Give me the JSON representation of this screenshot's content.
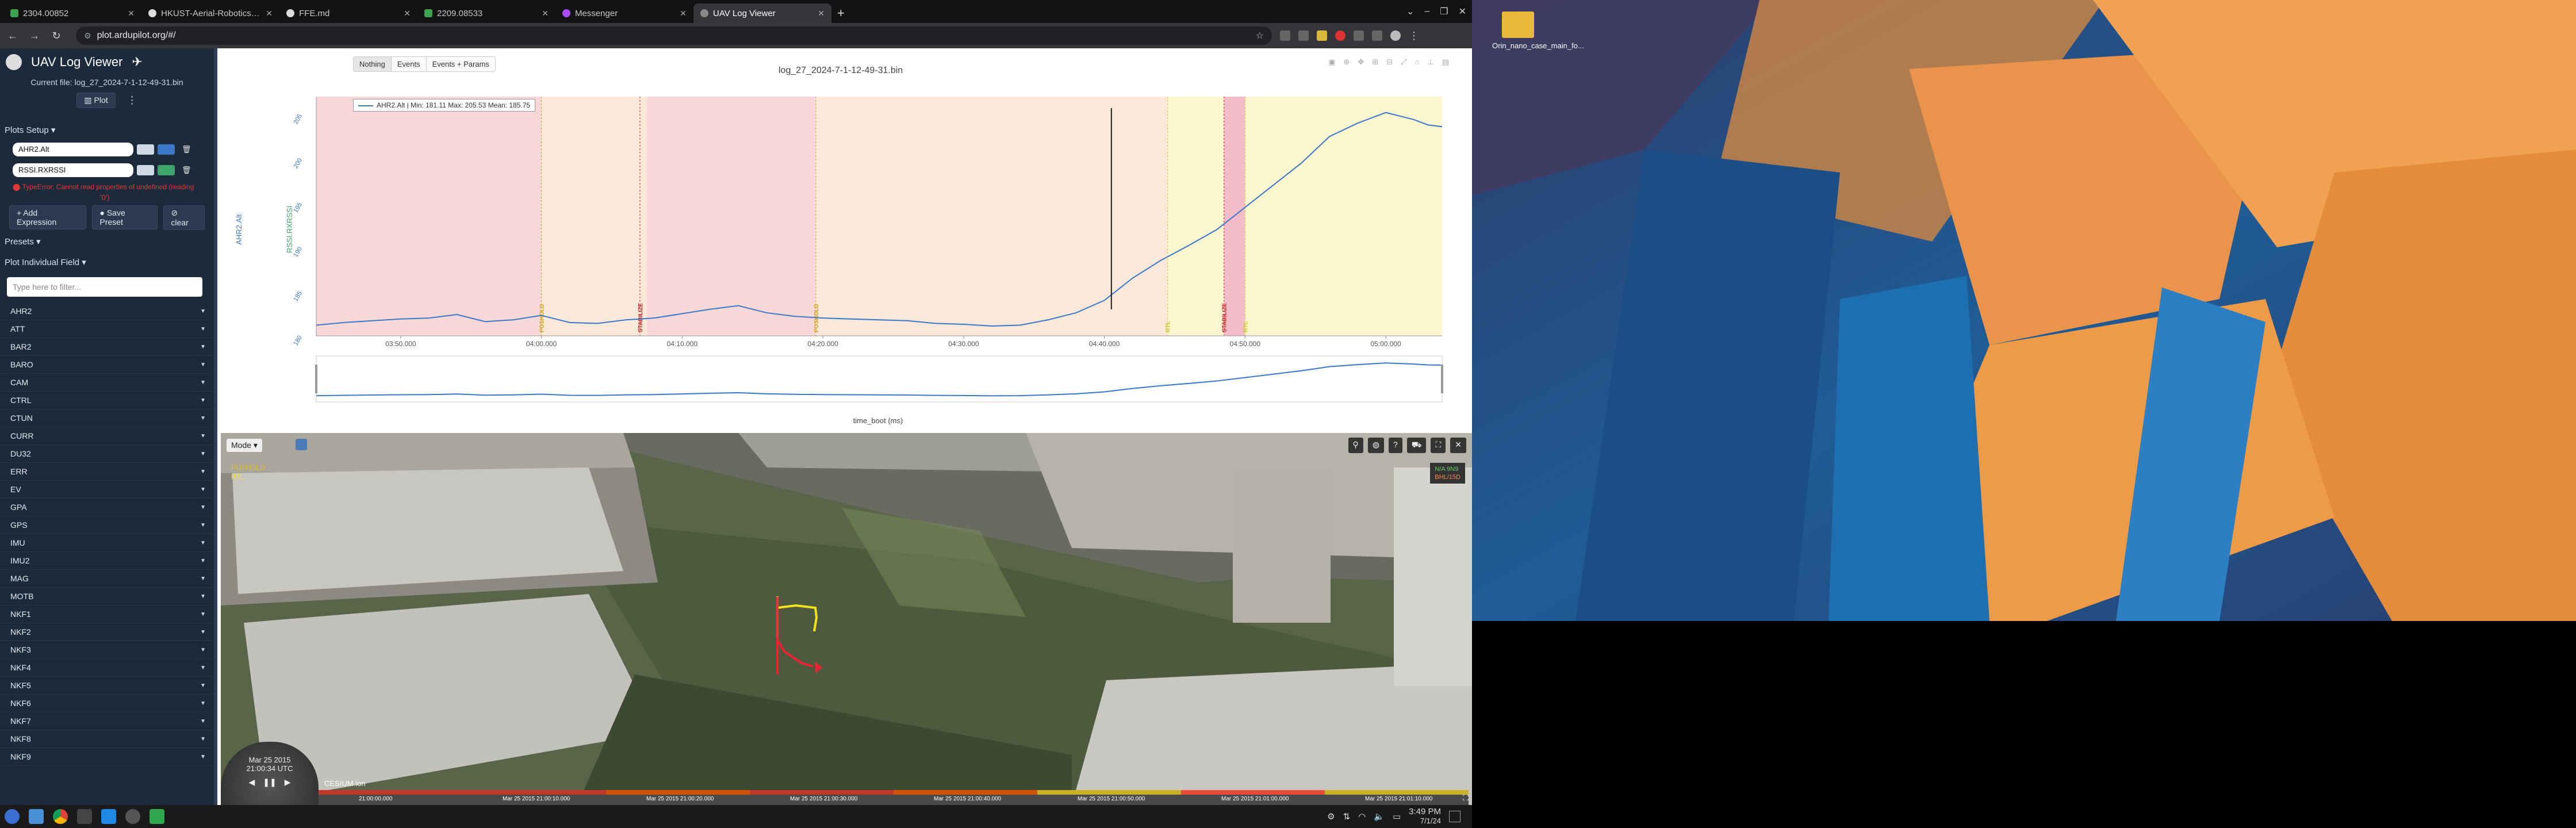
{
  "browser": {
    "tabs": [
      {
        "label": "2304.00852",
        "color": "#3fa34d"
      },
      {
        "label": "HKUST-Aerial-Robotics/FUEL",
        "color": "#dddddd"
      },
      {
        "label": "FFE.md",
        "color": "#dddddd"
      },
      {
        "label": "2209.08533",
        "color": "#3fa34d"
      },
      {
        "label": "Messenger",
        "color": "#a64dff"
      },
      {
        "label": "UAV Log Viewer",
        "color": "#888888"
      }
    ],
    "url": "plot.ardupilot.org/#/"
  },
  "sidebar": {
    "app_title": "UAV Log Viewer",
    "current_file": "Current file: log_27_2024-7-1-12-49-31.bin",
    "plot_button": "Plot",
    "plots_setup": "Plots Setup",
    "expressions": [
      "AHR2.Alt",
      "RSSI.RXRSSI"
    ],
    "error_text": "TypeError: Cannot read properties of undefined (reading",
    "error_text2": "'0')",
    "add_expression": "Add Expression",
    "save_preset": "Save Preset",
    "clear": "clear",
    "presets": "Presets",
    "plot_individual": "Plot Individual Field",
    "search_placeholder": "Type here to filter...",
    "fields": [
      "AHR2",
      "ATT",
      "BAR2",
      "BARO",
      "CAM",
      "CTRL",
      "CTUN",
      "CURR",
      "DU32",
      "ERR",
      "EV",
      "GPA",
      "GPS",
      "IMU",
      "IMU2",
      "MAG",
      "MOTB",
      "NKF1",
      "NKF2",
      "NKF3",
      "NKF4",
      "NKF5",
      "NKF6",
      "NKF7",
      "NKF8",
      "NKF9"
    ]
  },
  "plot": {
    "buttons": [
      "Nothing",
      "Events",
      "Events + Params"
    ],
    "title": "log_27_2024-7-1-12-49-31.bin",
    "legend": "AHR2.Alt | Min: 181.11    Max: 205.53    Mean: 185.75",
    "xlabel": "time_boot (ms)"
  },
  "chart_data": {
    "type": "line",
    "title": "log_27_2024-7-1-12-49-31.bin",
    "xlabel": "time_boot (ms)",
    "ylabel": "AHR2.Alt",
    "ylabel2": "RSSI.RXRSSI",
    "xticks": [
      "03:50.000",
      "04:00.000",
      "04:10.000",
      "04:20.000",
      "04:30.000",
      "04:40.000",
      "04:50.000",
      "05:00.000"
    ],
    "yticks": [
      "180",
      "185",
      "190",
      "195",
      "200",
      "205"
    ],
    "xlim_sec": [
      224,
      304
    ],
    "ylim": [
      180,
      207
    ],
    "series": [
      {
        "name": "AHR2.Alt",
        "color": "#3c78c8",
        "x": [
          224,
          226,
          228,
          230,
          232,
          234,
          236,
          238,
          240,
          242,
          244,
          246,
          248,
          250,
          252,
          254,
          256,
          258,
          260,
          262,
          264,
          266,
          268,
          270,
          272,
          274,
          276,
          278,
          280,
          282,
          284,
          286,
          288,
          290,
          292,
          294,
          296,
          298,
          300,
          302,
          303,
          304
        ],
        "y": [
          181.2,
          181.5,
          181.7,
          181.9,
          182.0,
          182.4,
          181.6,
          181.8,
          182.3,
          181.5,
          181.4,
          181.8,
          182.0,
          182.5,
          183.0,
          183.4,
          182.6,
          182.2,
          182.0,
          181.9,
          181.8,
          181.7,
          181.4,
          181.3,
          181.1,
          181.2,
          181.8,
          182.6,
          184.0,
          186.5,
          188.5,
          190.2,
          192.0,
          194.5,
          197.0,
          199.5,
          202.5,
          204.0,
          205.2,
          204.4,
          203.8,
          203.6
        ]
      }
    ],
    "mode_bands": [
      {
        "from": 224,
        "to": 240,
        "color": "#f8d7d8"
      },
      {
        "from": 240,
        "to": 247.5,
        "color": "#fae8d8"
      },
      {
        "from": 247.5,
        "to": 259.5,
        "color": "#f8d7d8"
      },
      {
        "from": 259.5,
        "to": 284.5,
        "color": "#fae8d8"
      },
      {
        "from": 284.5,
        "to": 288.5,
        "color": "#fbf6cf"
      },
      {
        "from": 288.5,
        "to": 290,
        "color": "#f4bcc8"
      },
      {
        "from": 290,
        "to": 304,
        "color": "#fbf6cf"
      }
    ],
    "events": [
      {
        "x": 240,
        "label": "POSHOLD",
        "color": "#d4a017"
      },
      {
        "x": 247,
        "label": "STABILIZE",
        "color": "#cc2222"
      },
      {
        "x": 259.5,
        "label": "POSHOLD",
        "color": "#d4a017"
      },
      {
        "x": 284.5,
        "label": "RTL",
        "color": "#c8c820"
      },
      {
        "x": 288.5,
        "label": "STABILIZE",
        "color": "#cc2222"
      },
      {
        "x": 290,
        "label": "RTL",
        "color": "#c8c820"
      }
    ],
    "cursor_x": 280.5
  },
  "map": {
    "mode_label": "Mode",
    "modes": [
      "POSHOLD",
      "RTL"
    ],
    "date_display": "Mar 25 2015",
    "time_display": "21:00:34 UTC",
    "timeline_labels": [
      "21:00:00.000",
      "Mar 25 2015 21:00:10.000",
      "Mar 25 2015 21:00:20.000",
      "Mar 25 2015 21:00:30.000",
      "Mar 25 2015 21:00:40.000",
      "Mar 25 2015 21:00:50.000",
      "Mar 25 2015 21:01:00.000",
      "Mar 25 2015 21:01:10.000"
    ],
    "attribution": "CESIUM ion",
    "info_box": [
      "N/A 9N9",
      "BHL/15D"
    ]
  },
  "taskbar": {
    "time": "3:49 PM",
    "date": "7/1/24"
  },
  "desktop": {
    "icon_label": "Orin_nano_case_main_fo..."
  }
}
